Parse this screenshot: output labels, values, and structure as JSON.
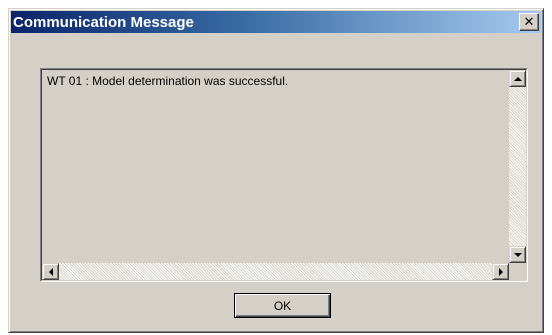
{
  "window": {
    "title": "Communication Message",
    "close_glyph": "✕"
  },
  "message": {
    "text": "WT 01 : Model determination was successful."
  },
  "buttons": {
    "ok_label": "OK"
  },
  "icons": {
    "close": "close-icon",
    "scroll_up": "scroll-up-arrow-icon",
    "scroll_down": "scroll-down-arrow-icon",
    "scroll_left": "scroll-left-arrow-icon",
    "scroll_right": "scroll-right-arrow-icon"
  },
  "colors": {
    "title_gradient_start": "#0a246a",
    "title_gradient_end": "#a6caf0",
    "dialog_face": "#d4d0c8"
  }
}
